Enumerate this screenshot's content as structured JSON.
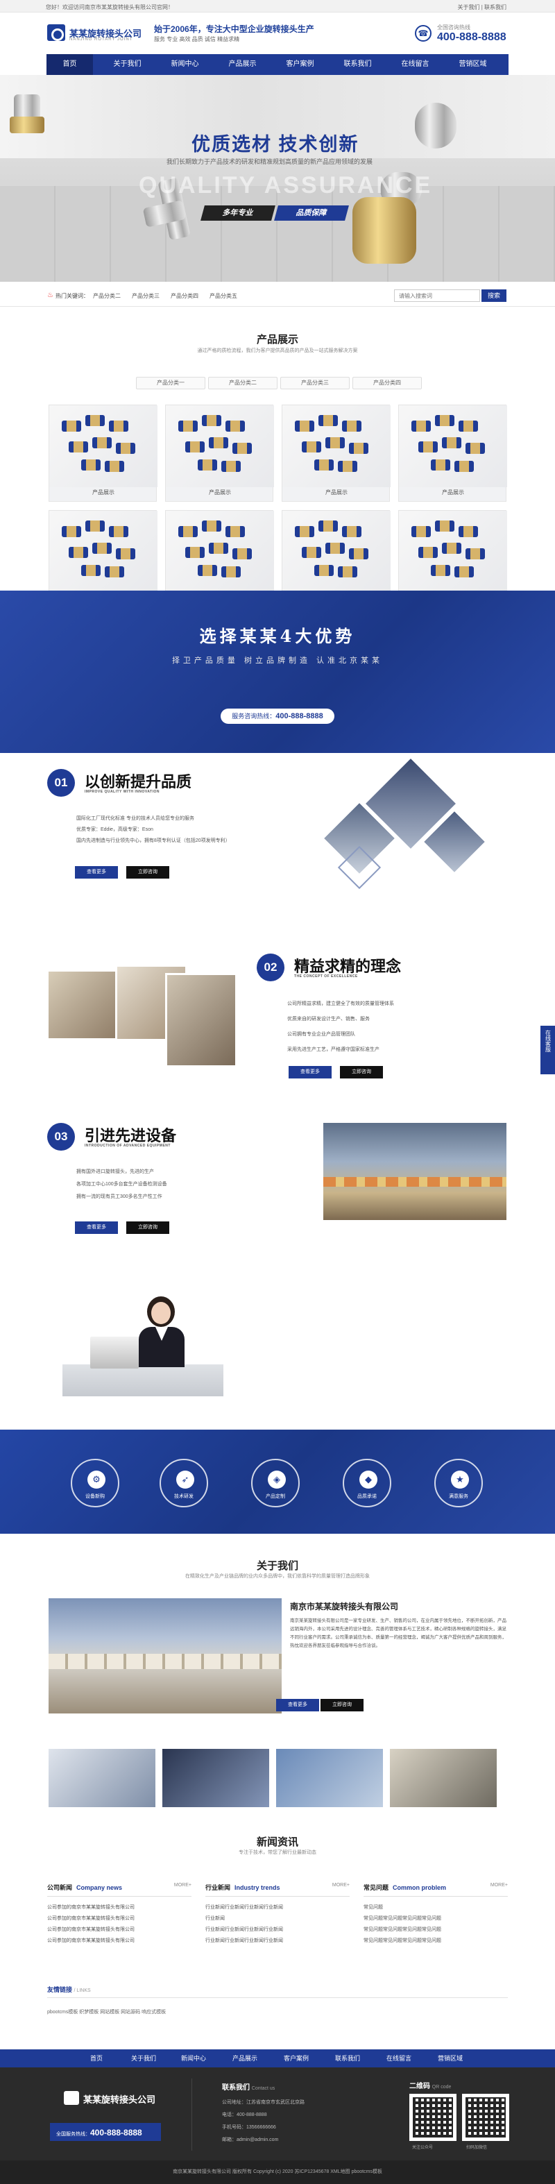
{
  "topbar": {
    "welcome": "您好！欢迎访问南京市某某旋转接头有限公司官网！",
    "links": "关于我们 | 联系我们"
  },
  "header": {
    "logo": "某某旋转接头公司",
    "logo_sub": "NANJING ROTARY JOINT",
    "slogan1": "始于2006年，专注大中型企业旋转接头生产",
    "slogan2": "服务 专业 高效 品质 诚信 精益求精",
    "phone_label": "全国咨询热线",
    "phone": "400-888-8888"
  },
  "nav": [
    "首页",
    "关于我们",
    "新闻中心",
    "产品展示",
    "客户案例",
    "联系我们",
    "在线留言",
    "营销区域"
  ],
  "banner": {
    "title": "优质选材  技术创新",
    "desc": "我们长期致力于产品技术的研发和精准规划高质量的新产品应用领域的发展",
    "ghost": "QUALITY ASSURANCE",
    "tag1": "多年专业",
    "tag2": "品质保障"
  },
  "hot": {
    "label": "热门关键词：",
    "keywords": [
      "产品分类二",
      "产品分类三",
      "产品分类四",
      "产品分类五"
    ],
    "search_placeholder": "请输入搜索词",
    "search_btn": "搜索"
  },
  "products": {
    "title": "产品展示",
    "sub": "通过严格的质检流程，我们为客户提供高品质的产品及一站式服务解决方案",
    "tabs": [
      "产品分类一",
      "产品分类二",
      "产品分类三",
      "产品分类四"
    ],
    "items": [
      "产品展示",
      "产品展示",
      "产品展示",
      "产品展示",
      "产品展示",
      "产品展示",
      "产品展示",
      "产品展示"
    ]
  },
  "advantage": {
    "title": "选择某某4大优势",
    "sub": "择卫产品质量  树立品牌制造  认准北京某某",
    "btn_label": "服务咨询热线：",
    "btn_phone": "400-888-8888"
  },
  "feature1": {
    "num": "01",
    "title": "以创新提升品质",
    "sub": "IMPROVE QUALITY WITH INNOVATION",
    "items": [
      "国际化工厂现代化标准 专业的技术人员给您专业的服务",
      "优质专家：Eddie，高级专家：Eson",
      "国内先进制造与行业领先中心，拥有8项专利认证（包括20项发明专利）"
    ],
    "btn1": "查看更多",
    "btn2": "立即咨询"
  },
  "feature2": {
    "num": "02",
    "title": "精益求精的理念",
    "sub": "THE CONCEPT OF EXCELLENCE",
    "items": [
      "公司所精益求精，建立健全了有效的质量管理体系",
      "优质来自的研发设计生产、销售、服务",
      "公司拥有专业企业产品管理团队",
      "采用先进生产工艺，严格遵守国家标准生产"
    ],
    "btn1": "查看更多",
    "btn2": "立即咨询"
  },
  "feature3": {
    "num": "03",
    "title": "引进先进设备",
    "sub": "INTRODUCTION OF ADVANCED EQUIPMENT",
    "items": [
      "拥有国外进口旋转接头，先进的生产",
      "各项加工中心100多台套生产设备检测设备",
      "拥有一流的现有员工300多名生产性工作"
    ],
    "btn1": "查看更多",
    "btn2": "立即咨询"
  },
  "services": [
    "设备新购",
    "技术研发",
    "产品定制",
    "品质承诺",
    "满意服务"
  ],
  "about": {
    "title": "关于我们",
    "sub": "在精致化生产及产业链品牌的业内众多品牌中，我们依靠科学的质量管理打造品牌形象",
    "company": "南京市某某旋转接头有限公司",
    "text": "南京某某旋转接头有限公司是一家专业研发、生产、销售的公司，在业内属于领先地位，不断开拓创新，产品远销海内外，本公司采用先进的设计理念、完善的管理体系与工艺技术，精心研制各种规格的旋转接头，满足不同行业客户的需求。公司秉承诚信为本、质量第一的经营理念，竭诚为广大客户提供优质产品和周到服务，热忱欢迎各界朋友莅临参观指导与合作洽谈。",
    "btn1": "查看更多",
    "btn2": "立即咨询"
  },
  "news": {
    "title": "新闻资讯",
    "sub": "专注于技术，带您了解行业最新动态",
    "more": "MORE+",
    "cols": [
      {
        "cn": "公司新闻",
        "en": "Company news",
        "items": [
          "公司参加的南京市某某旋转接头有限公司",
          "公司参加的南京市某某旋转接头有限公司",
          "公司参加的南京市某某旋转接头有限公司",
          "公司参加的南京市某某旋转接头有限公司"
        ]
      },
      {
        "cn": "行业新闻",
        "en": "Industry trends",
        "items": [
          "行业新闻行业新闻行业新闻行业新闻",
          "行业新闻",
          "行业新闻行业新闻行业新闻行业新闻",
          "行业新闻行业新闻行业新闻行业新闻"
        ]
      },
      {
        "cn": "常见问题",
        "en": "Common problem",
        "items": [
          "常见问题",
          "常见问题常见问题常见问题常见问题",
          "常见问题常见问题常见问题常见问题",
          "常见问题常见问题常见问题常见问题"
        ]
      }
    ]
  },
  "links": {
    "title": "友情链接",
    "en": "/ LINKS",
    "items": "pbootcms模板 织梦模板 网站模板 网站源码 响应式模板"
  },
  "footer_nav": [
    "首页",
    "关于我们",
    "新闻中心",
    "产品展示",
    "客户案例",
    "联系我们",
    "在线留言",
    "营销区域"
  ],
  "footer": {
    "logo": "某某旋转接头公司",
    "phone_label": "全国服务热线：",
    "phone": "400-888-8888",
    "contact_title": "联系我们",
    "contact_en": "Contact us",
    "address": "公司地址：江苏省南京市玄武区北京路",
    "tel": "电话：400-888-8888",
    "mobile": "手机号码：13566666666",
    "email": "邮箱：admin@admin.com",
    "qr_title": "二维码",
    "qr_en": "QR code",
    "qr1": "关注公众号",
    "qr2": "扫码加微信"
  },
  "copyright": "南京某某旋转接头有限公司 版权所有 Copyright (c) 2020 苏ICP12345678 XML地图 pbootcms模板",
  "float": "在线客服"
}
